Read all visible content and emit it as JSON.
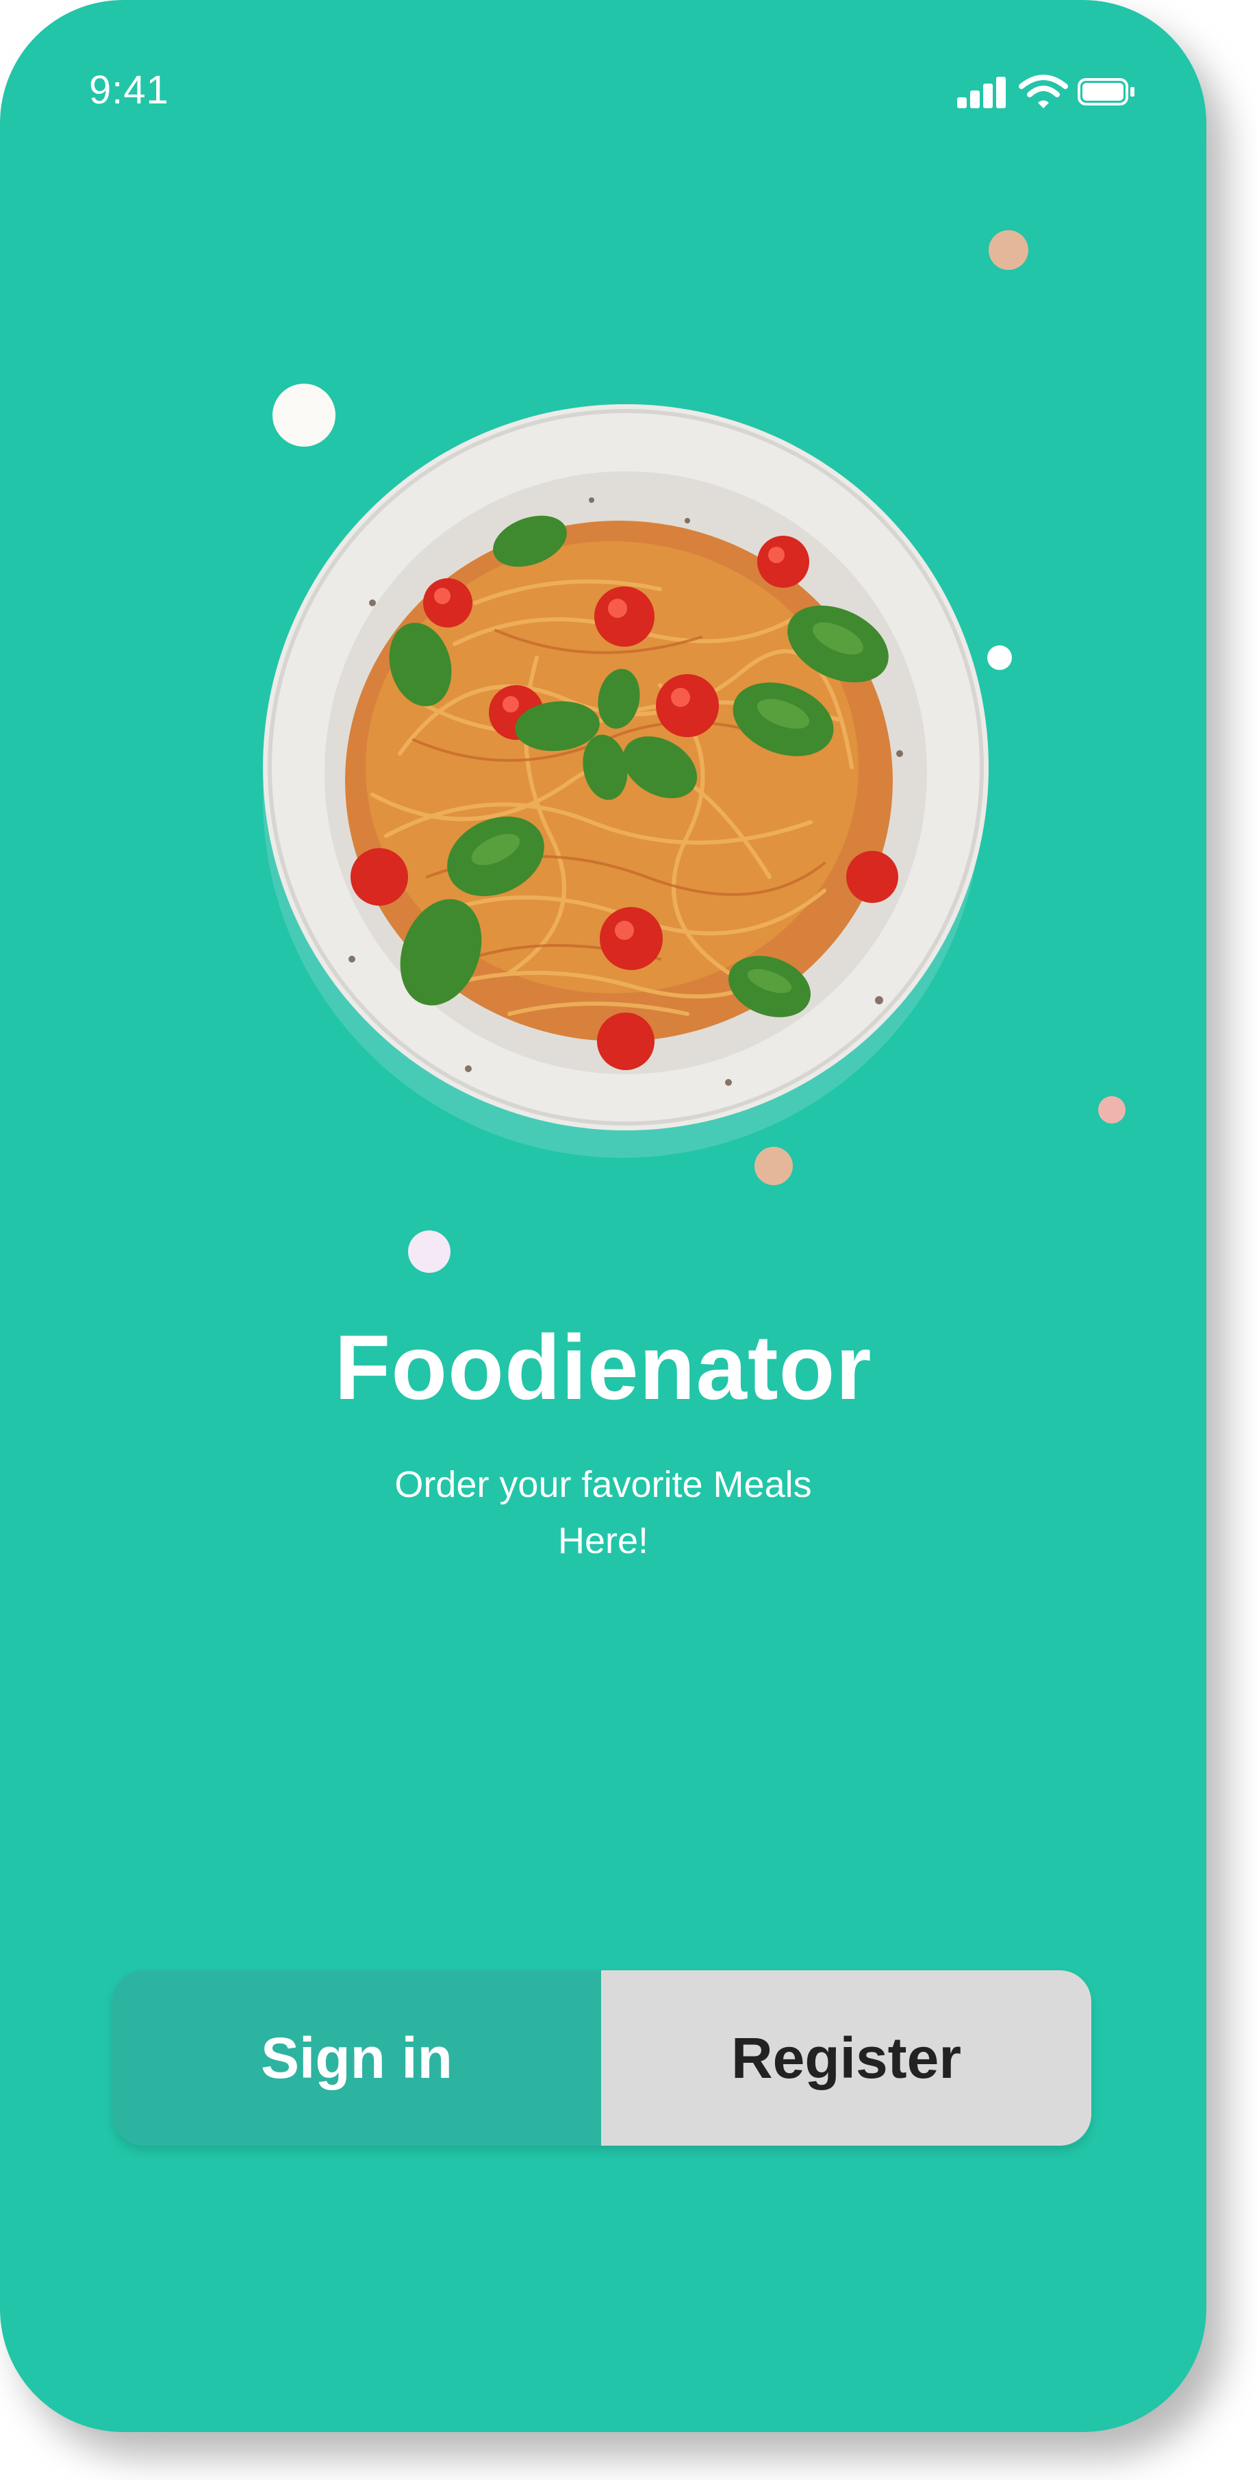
{
  "status_bar": {
    "time": "9:41",
    "icons": [
      "signal-icon",
      "wifi-icon",
      "battery-icon"
    ]
  },
  "hero": {
    "image": "spaghetti-plate-image",
    "decorative_dot_colors": [
      "#e5b79a",
      "#ffffff",
      "#f0b4ae",
      "#f5e9f5"
    ]
  },
  "brand": {
    "title": "Foodienator",
    "tagline_line1": "Order your favorite Meals",
    "tagline_line2": "Here!"
  },
  "auth": {
    "signin_label": "Sign in",
    "register_label": "Register"
  },
  "colors": {
    "background": "#22c5a8",
    "signin_button": "#2db4a0",
    "register_button": "#dadada",
    "text_light": "#ffffff",
    "text_dark": "#222222"
  }
}
